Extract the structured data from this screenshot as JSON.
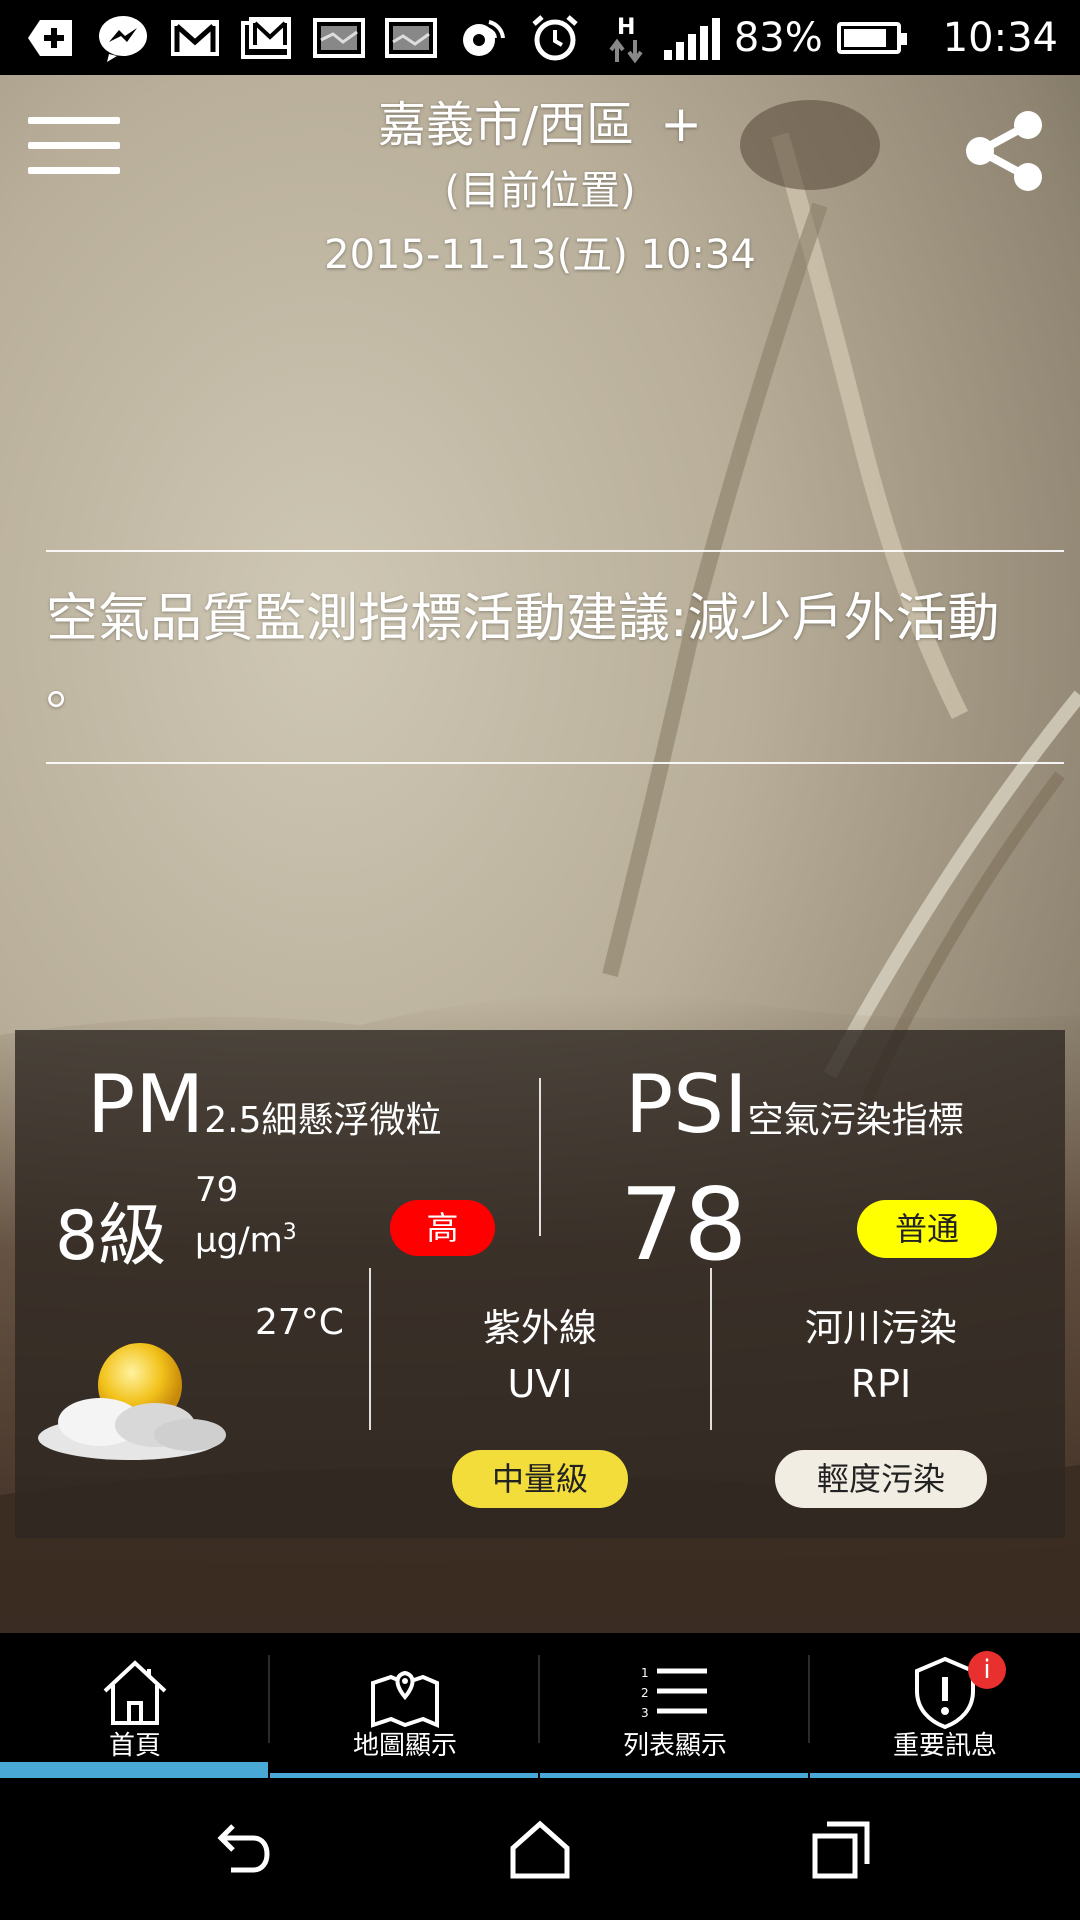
{
  "status_bar": {
    "icons": [
      "add-icon",
      "messenger-icon",
      "gmail-icon",
      "gmail-icon",
      "image-icon",
      "image-icon",
      "nfc-icon",
      "alarm-icon",
      "data-h-icon",
      "signal-icon",
      "battery-icon"
    ],
    "battery": "83%",
    "battery_level": 0.83,
    "time": "10:34"
  },
  "header": {
    "location": "嘉義市/西區",
    "add": "+",
    "sublabel": "(目前位置)",
    "datetime": "2015-11-13(五) 10:34"
  },
  "advice": {
    "text": "空氣品質監測指標活動建議:減少戶外活動 。"
  },
  "pm25": {
    "title": "PM",
    "subscript": "2.5",
    "description": "細懸浮微粒",
    "level": "8級",
    "value": "79",
    "unit": "μg/m",
    "unit_exp": "3",
    "badge": "高",
    "badge_color": "#ff0000"
  },
  "psi": {
    "title": "PSI",
    "description": "空氣污染指標",
    "value": "78",
    "badge": "普通",
    "badge_color": "#ffff00"
  },
  "weather": {
    "temperature": "27°C",
    "icon": "partly-cloudy-icon"
  },
  "uv": {
    "label": "紫外線",
    "code": "UVI",
    "badge": "中量級"
  },
  "river": {
    "label": "河川污染",
    "code": "RPI",
    "badge": "輕度污染"
  },
  "bottom_nav": {
    "items": [
      {
        "label": "首頁",
        "icon": "home-icon"
      },
      {
        "label": "地圖顯示",
        "icon": "map-icon"
      },
      {
        "label": "列表顯示",
        "icon": "list-icon"
      },
      {
        "label": "重要訊息",
        "icon": "shield-alert-icon"
      }
    ],
    "alert_badge": "i",
    "accent_color": "#4aa8d6"
  }
}
